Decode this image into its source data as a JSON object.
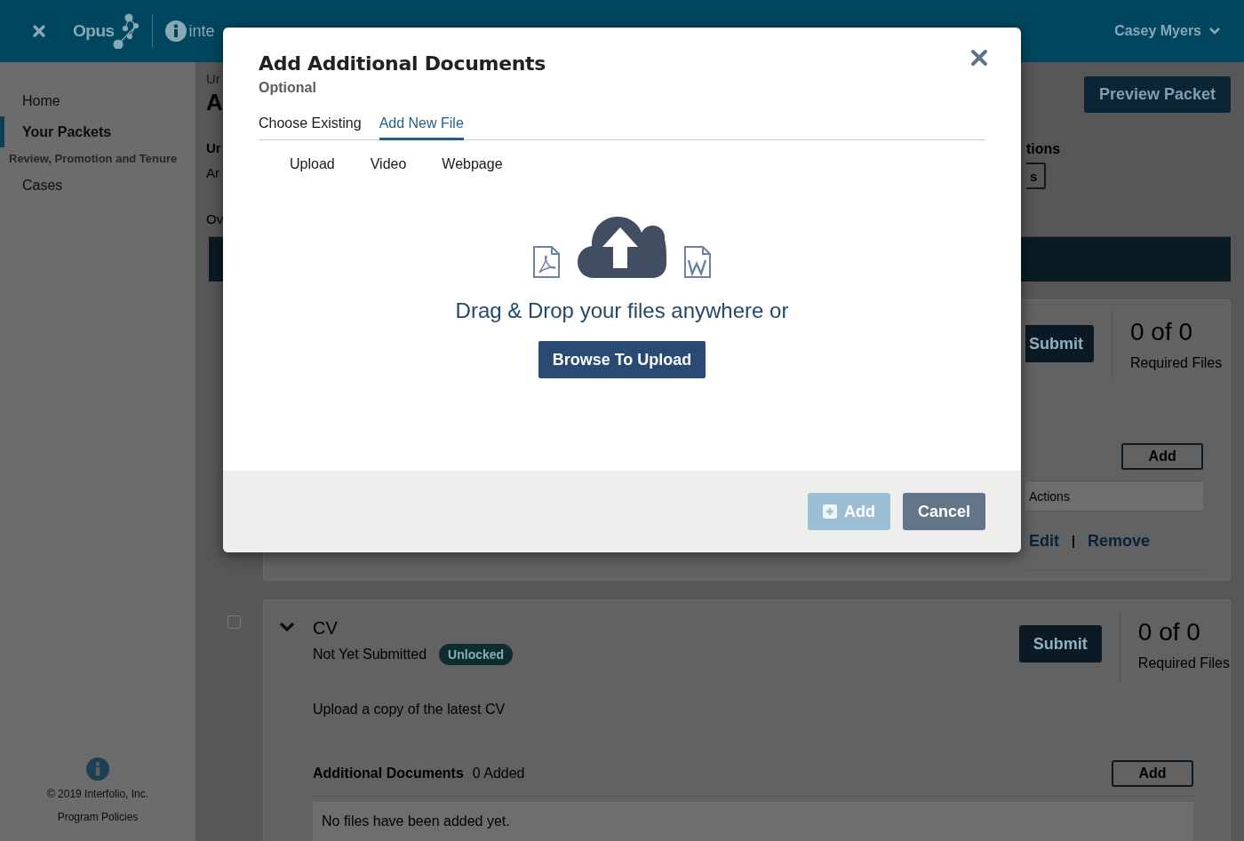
{
  "top_bar": {
    "logo": "Opus",
    "brand": "inte",
    "user": "Casey Myers"
  },
  "sidebar": {
    "items": [
      {
        "label": "Home",
        "selected": false
      },
      {
        "label": "Your Packets",
        "selected": true
      }
    ],
    "section_heading": "Review, Promotion and Tenure",
    "section_items": [
      {
        "label": "Cases",
        "selected": false
      }
    ],
    "copyright": "© 2019 Interfolio, Inc.",
    "policies_link": "Program Policies"
  },
  "page": {
    "fragments": [
      {
        "text": "Ur",
        "kind": "crumb"
      },
      {
        "text": "A",
        "kind": "title"
      },
      {
        "text": "Ur",
        "kind": "label"
      },
      {
        "text": "Ar",
        "kind": "text"
      },
      {
        "text": "Ov",
        "kind": "text"
      }
    ],
    "preview_button": "Preview Packet",
    "right_heading": "tions",
    "right_button": "s"
  },
  "first_card": {
    "submit": "Submit",
    "count": "0 of 0",
    "count_label": "Required Files",
    "add": "Add",
    "table_header": "Actions",
    "actions": [
      "Edit",
      "Remove"
    ],
    "separator": "|"
  },
  "cv_card": {
    "checked": false,
    "expanded": true,
    "title": "CV",
    "status": "Not Yet Submitted",
    "badge": "Unlocked",
    "description": "Upload a copy of the latest CV",
    "submit": "Submit",
    "count": "0 of 0",
    "count_label": "Required Files",
    "docs_label": "Additional Documents",
    "docs_count": "0 Added",
    "add": "Add",
    "empty": "No files have been added yet."
  },
  "modal": {
    "title": "Add Additional Documents",
    "subtitle": "Optional",
    "tabs": [
      {
        "label": "Choose Existing",
        "selected": false
      },
      {
        "label": "Add New File",
        "selected": true
      }
    ],
    "subtabs": [
      "Upload",
      "Video",
      "Webpage"
    ],
    "drop_text": "Drag & Drop your files anywhere or",
    "browse_button": "Browse To Upload",
    "buttons": [
      {
        "label": "Add",
        "kind": "primary",
        "disabled": true
      },
      {
        "label": "Cancel",
        "kind": "secondary",
        "disabled": false
      }
    ]
  }
}
